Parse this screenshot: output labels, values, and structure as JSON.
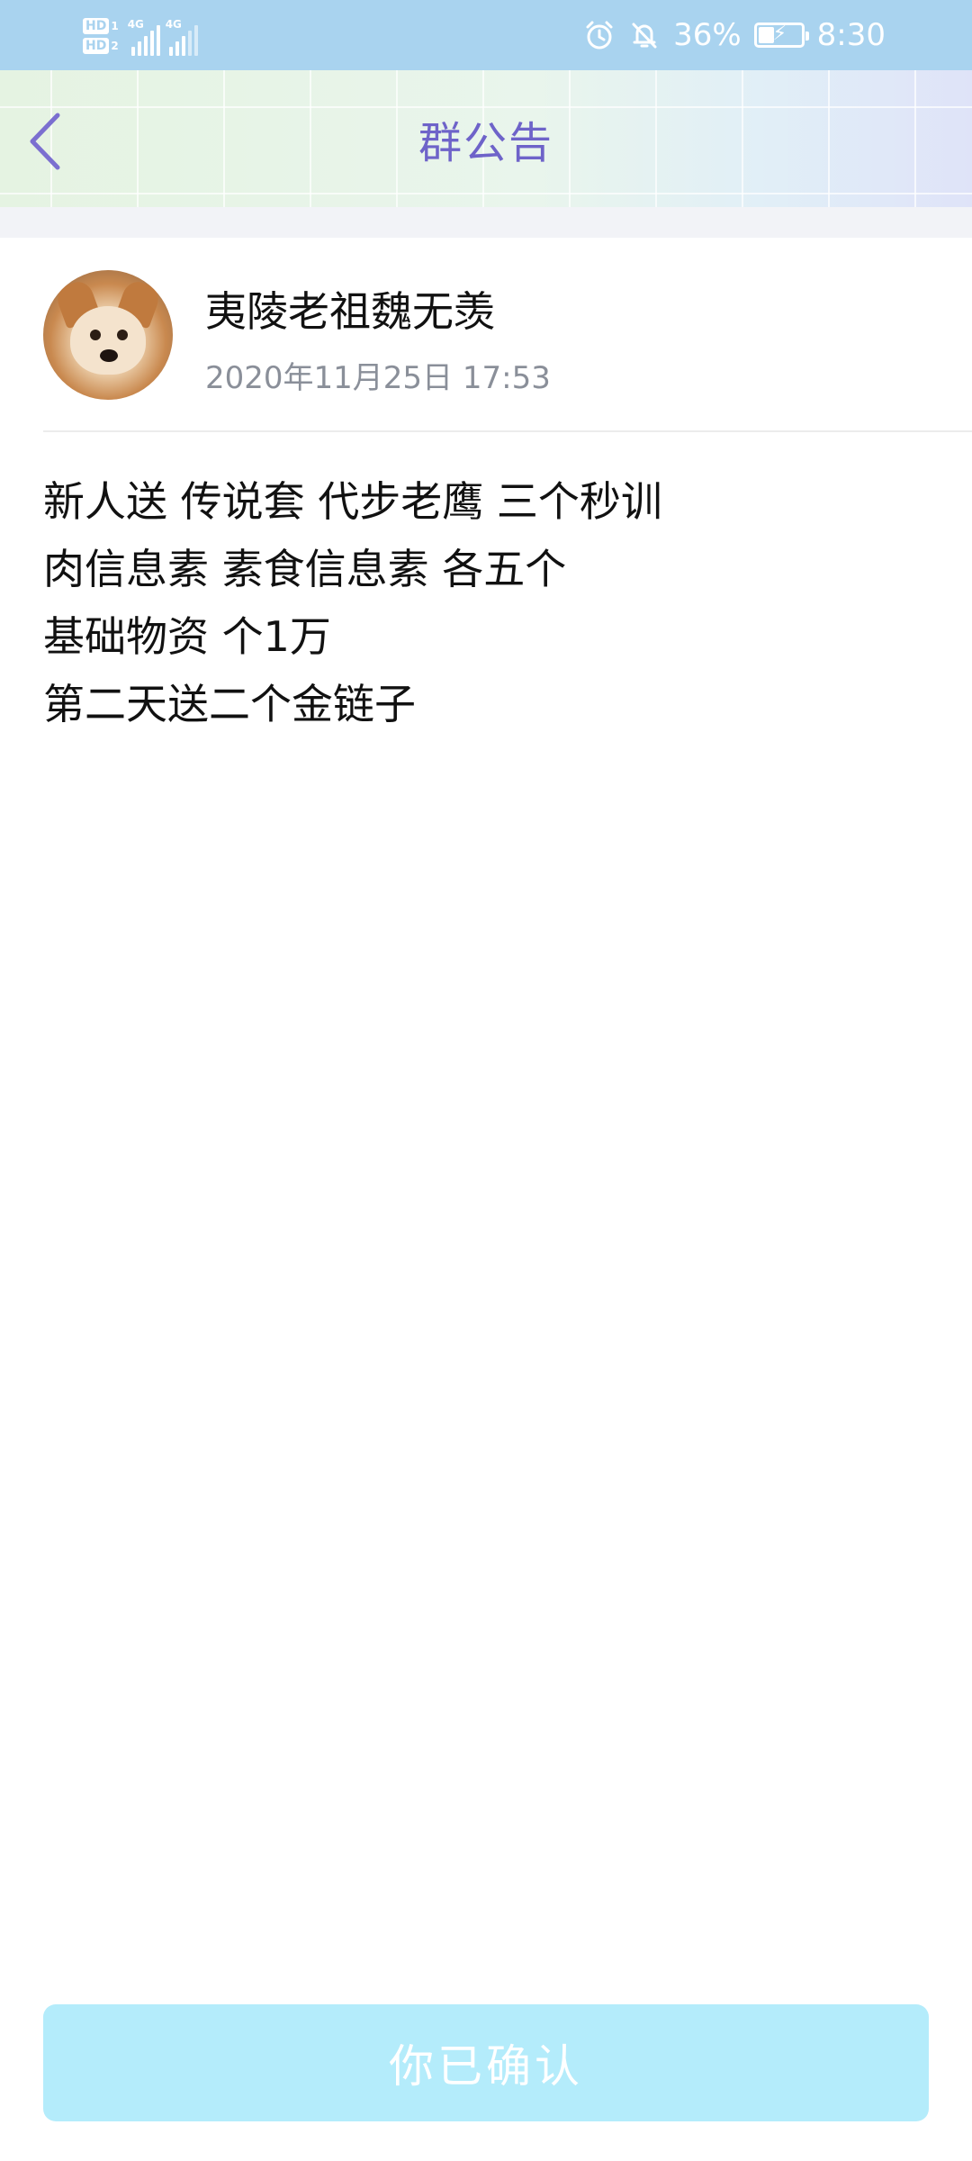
{
  "status_bar": {
    "hd1_label": "HD",
    "hd1_num": "1",
    "hd2_label": "HD",
    "hd2_num": "2",
    "net1": "4G",
    "net2": "4G",
    "battery_percent": "36%",
    "time": "8:30",
    "icons": [
      "alarm-icon",
      "mute-bell-icon",
      "battery-charging-icon"
    ]
  },
  "header": {
    "title": "群公告",
    "back_icon": "chevron-left-icon",
    "title_color": "#6e63c9"
  },
  "post": {
    "author": "夷陵老祖魏无羡",
    "timestamp": "2020年11月25日 17:53",
    "lines": [
      "新人送 传说套 代步老鹰 三个秒训",
      "肉信息素 素食信息素 各五个",
      "基础物资 个1万",
      "第二天送二个金链子"
    ]
  },
  "confirm": {
    "label": "你已确认",
    "color": "#b4ecfb"
  }
}
